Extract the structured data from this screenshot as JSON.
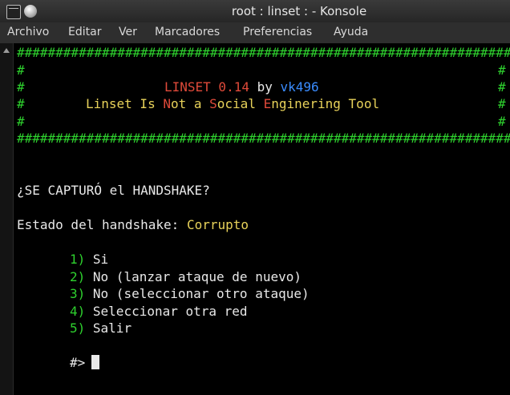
{
  "window": {
    "title": "root : linset : - Konsole"
  },
  "menu": [
    "Archivo",
    "Editar",
    "Ver",
    "Marcadores",
    "Preferencias",
    "Ayuda"
  ],
  "banner": {
    "border": "#################################################################",
    "side": "#",
    "app_name": "LINSET 0.14",
    "by": "by",
    "author": "vk496",
    "tagline_pre": "Linset Is ",
    "tagline_N": "N",
    "tagline_mid1": "ot a ",
    "tagline_S": "S",
    "tagline_mid2": "ocial ",
    "tagline_E": "E",
    "tagline_end": "nginering Tool"
  },
  "question": "¿SE CAPTURÓ el HANDSHAKE?",
  "status": {
    "label": "Estado del handshake:",
    "value": "Corrupto"
  },
  "options": [
    {
      "num": "1)",
      "text": "Si"
    },
    {
      "num": "2)",
      "text": "No (lanzar ataque de nuevo)"
    },
    {
      "num": "3)",
      "text": "No (seleccionar otro ataque)"
    },
    {
      "num": "4)",
      "text": "Seleccionar otra red"
    },
    {
      "num": "5)",
      "text": "Salir"
    }
  ],
  "prompt": "#>",
  "colors": {
    "green": "#2ed12e",
    "red": "#e04a3a",
    "blue": "#3a8cff",
    "yellow": "#e8d25a"
  }
}
